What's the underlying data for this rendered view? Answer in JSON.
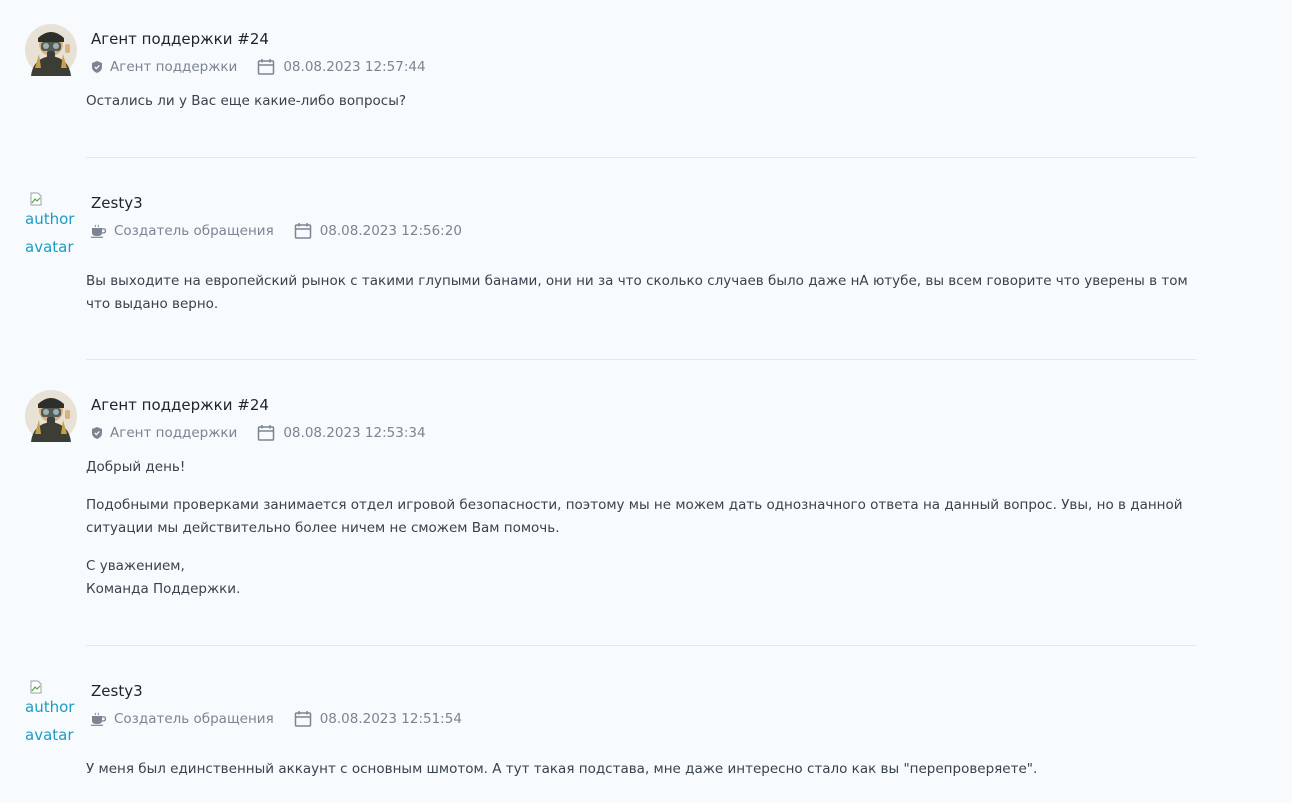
{
  "messages": [
    {
      "author": "Агент поддержки #24",
      "role": "Агент поддержки",
      "role_icon": "shield-icon",
      "datetime": "08.08.2023 12:57:44",
      "avatar_type": "image",
      "paragraphs": [
        "Остались ли у Вас еще какие-либо вопросы?"
      ]
    },
    {
      "author": "Zesty3",
      "role": "Создатель обращения",
      "role_icon": "coffee-icon",
      "datetime": "08.08.2023 12:56:20",
      "avatar_type": "broken",
      "avatar_alt": "author avatar",
      "paragraphs": [
        "Вы выходите на европейский рынок с такими глупыми банами, они ни за что сколько случаев было даже нА ютубе, вы всем говорите что уверены в том что выдано верно."
      ]
    },
    {
      "author": "Агент поддержки #24",
      "role": "Агент поддержки",
      "role_icon": "shield-icon",
      "datetime": "08.08.2023 12:53:34",
      "avatar_type": "image",
      "paragraphs": [
        "Добрый день!",
        "Подобными проверками занимается отдел игровой безопасности, поэтому мы не можем дать однозначного ответа на данный вопрос. Увы, но в данной ситуации мы действительно более ничем не сможем Вам помочь.",
        "С уважением,\nКоманда Поддержки."
      ]
    },
    {
      "author": "Zesty3",
      "role": "Создатель обращения",
      "role_icon": "coffee-icon",
      "datetime": "08.08.2023 12:51:54",
      "avatar_type": "broken",
      "avatar_alt": "author avatar",
      "paragraphs": [
        "У меня был единственный аккаунт с основным шмотом. А тут такая подстава, мне даже интересно стало как вы \"перепроверяете\"."
      ]
    }
  ]
}
